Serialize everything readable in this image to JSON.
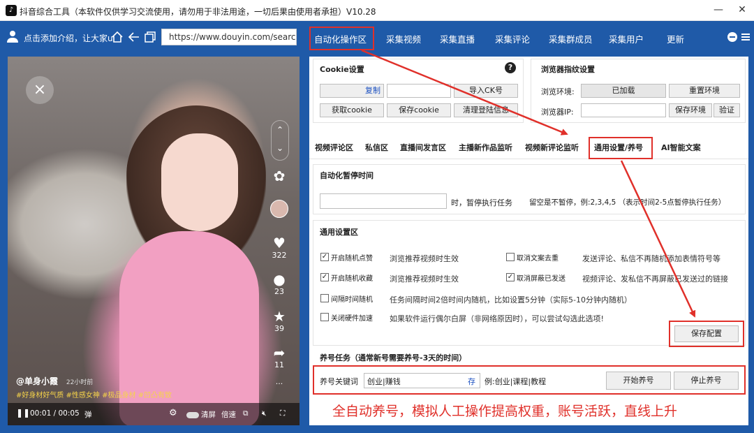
{
  "window": {
    "title": "抖音综合工具（本软件仅供学习交流使用，请勿用于非法用途，一切后果由使用者承担）V10.28",
    "controls": {
      "minimize": "—",
      "close": "✕"
    }
  },
  "nav": {
    "user_prompt": "点击添加介绍，让大家u",
    "url": "https://www.douyin.com/search/",
    "tabs": [
      "自动化操作区",
      "采集视频",
      "采集直播",
      "采集评论",
      "采集群成员",
      "采集用户",
      "更新"
    ]
  },
  "video": {
    "like_count": "322",
    "comment_count": "23",
    "star_count": "39",
    "share_count": "11",
    "author": "@单身小霞",
    "time_ago": "22小时前",
    "tags": "#好身材好气质 #性感女神 #极品身材 #凹凸有致",
    "time": "00:01 / 00:05",
    "ctrl_clear": "清屏",
    "ctrl_speed": "倍速",
    "more": "···"
  },
  "cookie": {
    "title": "Cookie设置",
    "copy_btn": "复制",
    "import_btn": "导入CK号",
    "get_btn": "获取cookie",
    "save_btn": "保存cookie",
    "clear_btn": "清理登陆信息"
  },
  "fingerprint": {
    "title": "浏览器指纹设置",
    "env_label": "浏览环境:",
    "env_value": "已加载",
    "reset_btn": "重置环境",
    "ip_label": "浏览器IP:",
    "save_env_btn": "保存环境",
    "verify_btn": "验证"
  },
  "subtabs": [
    "视频评论区",
    "私信区",
    "直播间发言区",
    "主播新作品监听",
    "视频新评论监听",
    "通用设置/养号",
    "AI智能文案"
  ],
  "pause": {
    "title": "自动化暂停时间",
    "suffix": "时，暂停执行任务",
    "hint": "留空是不暂停，例:2,3,4,5 （表示时间2-5点暂停执行任务）"
  },
  "general": {
    "title": "通用设置区",
    "options": [
      {
        "label": "开启随机点赞",
        "checked": true,
        "desc": "浏览推荐视频时生效"
      },
      {
        "label": "取消文案去重",
        "checked": false,
        "desc": "发送评论、私信不再随机添加表情符号等"
      },
      {
        "label": "开启随机收藏",
        "checked": true,
        "desc": "浏览推荐视频时生效"
      },
      {
        "label": "取消屏蔽已发送",
        "checked": true,
        "desc": "视频评论、发私信不再屏蔽已发送过的链接"
      },
      {
        "label": "间隔时间随机",
        "checked": false,
        "desc": "任务间隔时间2倍时间内随机，比如设置5分钟（实际5-10分钟内随机）"
      },
      {
        "label": "关闭硬件加速",
        "checked": false,
        "desc": "如果软件运行偶尔白屏（非网络原因时），可以尝试勾选此选项!"
      }
    ],
    "save_btn": "保存配置"
  },
  "nurture": {
    "title": "养号任务（通常新号需要养号-3天的时间）",
    "keyword_label": "养号关键词",
    "keyword_value": "创业|赚钱",
    "save_link": "存",
    "example": "例:创业|课程|教程",
    "start_btn": "开始养号",
    "stop_btn": "停止养号"
  },
  "annotation": "全自动养号，模拟人工操作提高权重，账号活跃，直线上升",
  "colors": {
    "nav_bg": "#1f5aa8",
    "annotation_red": "#e0302a",
    "tag_yellow": "#f5d34a"
  }
}
